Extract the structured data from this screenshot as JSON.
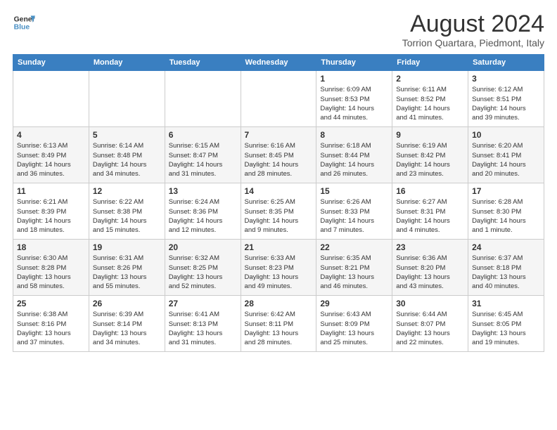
{
  "logo": {
    "line1": "General",
    "line2": "Blue"
  },
  "title": "August 2024",
  "location": "Torrion Quartara, Piedmont, Italy",
  "weekdays": [
    "Sunday",
    "Monday",
    "Tuesday",
    "Wednesday",
    "Thursday",
    "Friday",
    "Saturday"
  ],
  "weeks": [
    [
      {
        "day": "",
        "info": ""
      },
      {
        "day": "",
        "info": ""
      },
      {
        "day": "",
        "info": ""
      },
      {
        "day": "",
        "info": ""
      },
      {
        "day": "1",
        "info": "Sunrise: 6:09 AM\nSunset: 8:53 PM\nDaylight: 14 hours\nand 44 minutes."
      },
      {
        "day": "2",
        "info": "Sunrise: 6:11 AM\nSunset: 8:52 PM\nDaylight: 14 hours\nand 41 minutes."
      },
      {
        "day": "3",
        "info": "Sunrise: 6:12 AM\nSunset: 8:51 PM\nDaylight: 14 hours\nand 39 minutes."
      }
    ],
    [
      {
        "day": "4",
        "info": "Sunrise: 6:13 AM\nSunset: 8:49 PM\nDaylight: 14 hours\nand 36 minutes."
      },
      {
        "day": "5",
        "info": "Sunrise: 6:14 AM\nSunset: 8:48 PM\nDaylight: 14 hours\nand 34 minutes."
      },
      {
        "day": "6",
        "info": "Sunrise: 6:15 AM\nSunset: 8:47 PM\nDaylight: 14 hours\nand 31 minutes."
      },
      {
        "day": "7",
        "info": "Sunrise: 6:16 AM\nSunset: 8:45 PM\nDaylight: 14 hours\nand 28 minutes."
      },
      {
        "day": "8",
        "info": "Sunrise: 6:18 AM\nSunset: 8:44 PM\nDaylight: 14 hours\nand 26 minutes."
      },
      {
        "day": "9",
        "info": "Sunrise: 6:19 AM\nSunset: 8:42 PM\nDaylight: 14 hours\nand 23 minutes."
      },
      {
        "day": "10",
        "info": "Sunrise: 6:20 AM\nSunset: 8:41 PM\nDaylight: 14 hours\nand 20 minutes."
      }
    ],
    [
      {
        "day": "11",
        "info": "Sunrise: 6:21 AM\nSunset: 8:39 PM\nDaylight: 14 hours\nand 18 minutes."
      },
      {
        "day": "12",
        "info": "Sunrise: 6:22 AM\nSunset: 8:38 PM\nDaylight: 14 hours\nand 15 minutes."
      },
      {
        "day": "13",
        "info": "Sunrise: 6:24 AM\nSunset: 8:36 PM\nDaylight: 14 hours\nand 12 minutes."
      },
      {
        "day": "14",
        "info": "Sunrise: 6:25 AM\nSunset: 8:35 PM\nDaylight: 14 hours\nand 9 minutes."
      },
      {
        "day": "15",
        "info": "Sunrise: 6:26 AM\nSunset: 8:33 PM\nDaylight: 14 hours\nand 7 minutes."
      },
      {
        "day": "16",
        "info": "Sunrise: 6:27 AM\nSunset: 8:31 PM\nDaylight: 14 hours\nand 4 minutes."
      },
      {
        "day": "17",
        "info": "Sunrise: 6:28 AM\nSunset: 8:30 PM\nDaylight: 14 hours\nand 1 minute."
      }
    ],
    [
      {
        "day": "18",
        "info": "Sunrise: 6:30 AM\nSunset: 8:28 PM\nDaylight: 13 hours\nand 58 minutes."
      },
      {
        "day": "19",
        "info": "Sunrise: 6:31 AM\nSunset: 8:26 PM\nDaylight: 13 hours\nand 55 minutes."
      },
      {
        "day": "20",
        "info": "Sunrise: 6:32 AM\nSunset: 8:25 PM\nDaylight: 13 hours\nand 52 minutes."
      },
      {
        "day": "21",
        "info": "Sunrise: 6:33 AM\nSunset: 8:23 PM\nDaylight: 13 hours\nand 49 minutes."
      },
      {
        "day": "22",
        "info": "Sunrise: 6:35 AM\nSunset: 8:21 PM\nDaylight: 13 hours\nand 46 minutes."
      },
      {
        "day": "23",
        "info": "Sunrise: 6:36 AM\nSunset: 8:20 PM\nDaylight: 13 hours\nand 43 minutes."
      },
      {
        "day": "24",
        "info": "Sunrise: 6:37 AM\nSunset: 8:18 PM\nDaylight: 13 hours\nand 40 minutes."
      }
    ],
    [
      {
        "day": "25",
        "info": "Sunrise: 6:38 AM\nSunset: 8:16 PM\nDaylight: 13 hours\nand 37 minutes."
      },
      {
        "day": "26",
        "info": "Sunrise: 6:39 AM\nSunset: 8:14 PM\nDaylight: 13 hours\nand 34 minutes."
      },
      {
        "day": "27",
        "info": "Sunrise: 6:41 AM\nSunset: 8:13 PM\nDaylight: 13 hours\nand 31 minutes."
      },
      {
        "day": "28",
        "info": "Sunrise: 6:42 AM\nSunset: 8:11 PM\nDaylight: 13 hours\nand 28 minutes."
      },
      {
        "day": "29",
        "info": "Sunrise: 6:43 AM\nSunset: 8:09 PM\nDaylight: 13 hours\nand 25 minutes."
      },
      {
        "day": "30",
        "info": "Sunrise: 6:44 AM\nSunset: 8:07 PM\nDaylight: 13 hours\nand 22 minutes."
      },
      {
        "day": "31",
        "info": "Sunrise: 6:45 AM\nSunset: 8:05 PM\nDaylight: 13 hours\nand 19 minutes."
      }
    ]
  ]
}
